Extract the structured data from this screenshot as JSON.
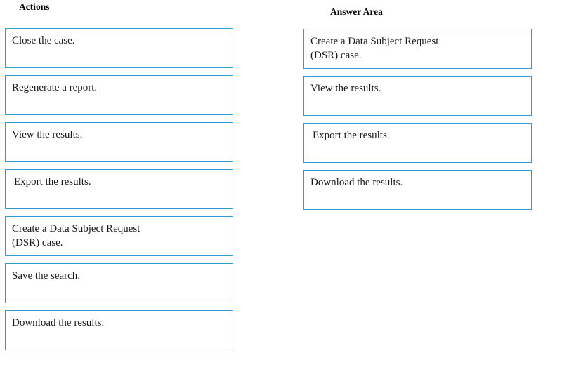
{
  "theme": {
    "tile_border_color": "#2e9bd4",
    "background_color": "#ffffff",
    "text_color": "#1a1a1a"
  },
  "actions": {
    "header": "Actions",
    "items": [
      {
        "label": "Close the case."
      },
      {
        "label": "Regenerate a report."
      },
      {
        "label": "View the results."
      },
      {
        "label": "Export the results."
      },
      {
        "label": "Create a Data Subject Request\n(DSR) case."
      },
      {
        "label": "Save the search."
      },
      {
        "label": "Download the results."
      }
    ]
  },
  "answer_area": {
    "header": "Answer Area",
    "items": [
      {
        "label": "Create a Data Subject Request\n(DSR) case."
      },
      {
        "label": "View the results."
      },
      {
        "label": "Export the results."
      },
      {
        "label": "Download the results."
      }
    ]
  }
}
